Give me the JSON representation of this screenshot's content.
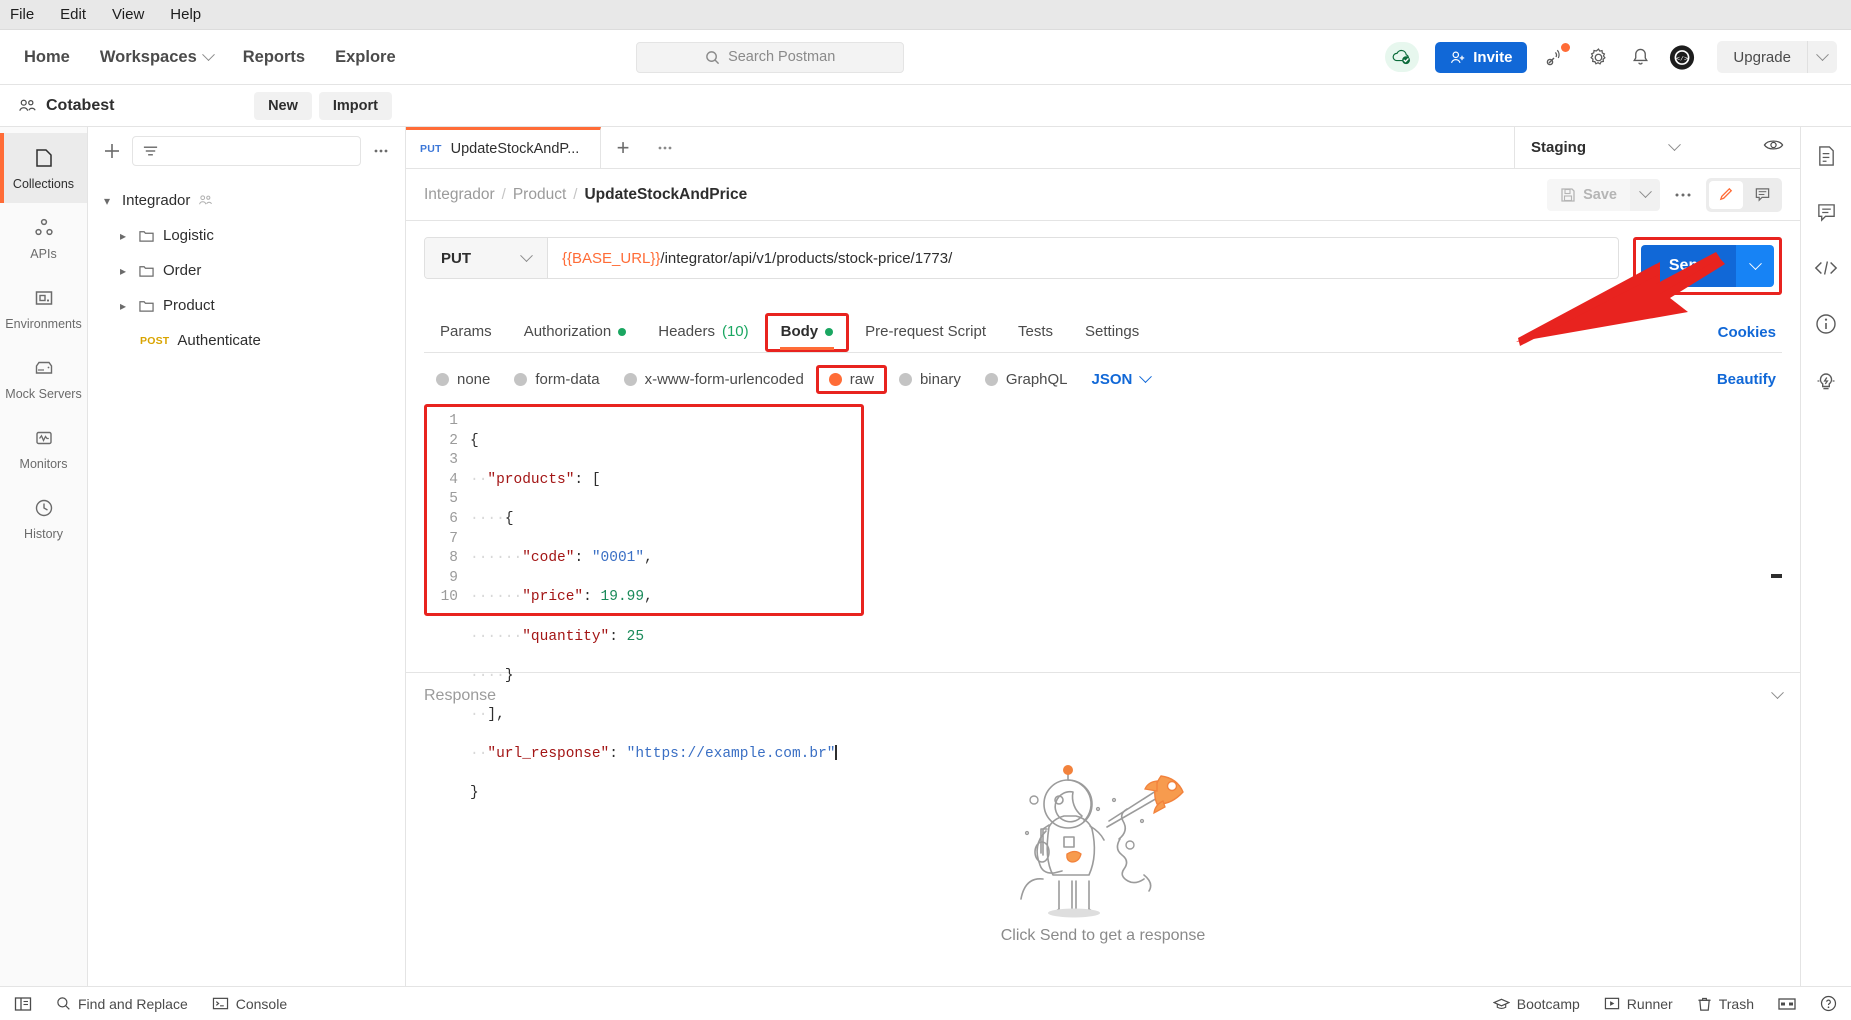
{
  "os_menu": [
    "File",
    "Edit",
    "View",
    "Help"
  ],
  "topnav": {
    "items": [
      "Home",
      "Workspaces",
      "Reports",
      "Explore"
    ],
    "search_placeholder": "Search Postman",
    "invite_label": "Invite",
    "upgrade_label": "Upgrade"
  },
  "workspace": {
    "name": "Cotabest",
    "new_label": "New",
    "import_label": "Import"
  },
  "rail": [
    {
      "label": "Collections",
      "icon": "collections-icon"
    },
    {
      "label": "APIs",
      "icon": "apis-icon"
    },
    {
      "label": "Environments",
      "icon": "environments-icon"
    },
    {
      "label": "Mock Servers",
      "icon": "mock-servers-icon"
    },
    {
      "label": "Monitors",
      "icon": "monitors-icon"
    },
    {
      "label": "History",
      "icon": "history-icon"
    }
  ],
  "collections": {
    "filter_placeholder": "",
    "root": "Integrador",
    "folders": [
      "Logistic",
      "Order",
      "Product"
    ],
    "request": {
      "method": "POST",
      "name": "Authenticate"
    }
  },
  "tab": {
    "method": "PUT",
    "title": "UpdateStockAndP...",
    "env_name": "Staging"
  },
  "breadcrumb": {
    "collection": "Integrador",
    "folder": "Product",
    "request": "UpdateStockAndPrice",
    "save_label": "Save"
  },
  "request": {
    "method": "PUT",
    "url_variable": "{{BASE_URL}}",
    "url_path": "/integrator/api/v1/products/stock-price/1773/",
    "send_label": "Send"
  },
  "request_tabs": [
    {
      "label": "Params",
      "dot": false,
      "count": null,
      "selected": false,
      "highlighted": false
    },
    {
      "label": "Authorization",
      "dot": true,
      "count": null,
      "selected": false,
      "highlighted": false
    },
    {
      "label": "Headers",
      "dot": false,
      "count": "(10)",
      "selected": false,
      "highlighted": false
    },
    {
      "label": "Body",
      "dot": true,
      "count": null,
      "selected": true,
      "highlighted": true
    },
    {
      "label": "Pre-request Script",
      "dot": false,
      "count": null,
      "selected": false,
      "highlighted": false
    },
    {
      "label": "Tests",
      "dot": false,
      "count": null,
      "selected": false,
      "highlighted": false
    },
    {
      "label": "Settings",
      "dot": false,
      "count": null,
      "selected": false,
      "highlighted": false
    }
  ],
  "cookies_label": "Cookies",
  "body_types": [
    {
      "label": "none",
      "selected": false,
      "highlighted": false
    },
    {
      "label": "form-data",
      "selected": false,
      "highlighted": false
    },
    {
      "label": "x-www-form-urlencoded",
      "selected": false,
      "highlighted": false
    },
    {
      "label": "raw",
      "selected": true,
      "highlighted": true
    },
    {
      "label": "binary",
      "selected": false,
      "highlighted": false
    },
    {
      "label": "GraphQL",
      "selected": false,
      "highlighted": false
    }
  ],
  "body_format": "JSON",
  "beautify_label": "Beautify",
  "editor": {
    "line_numbers": [
      "1",
      "2",
      "3",
      "4",
      "5",
      "6",
      "7",
      "8",
      "9",
      "10"
    ],
    "code_lines": [
      "{",
      "  \"products\": [",
      "    {",
      "      \"code\": \"0001\",",
      "      \"price\": 19.99,",
      "      \"quantity\": 25",
      "    }",
      "  ],",
      "  \"url_response\": \"https://example.com.br\"",
      "}"
    ]
  },
  "response": {
    "title": "Response",
    "hint": "Click Send to get a response"
  },
  "statusbar": {
    "left": [
      "Find and Replace",
      "Console"
    ],
    "right": [
      "Bootcamp",
      "Runner",
      "Trash"
    ]
  },
  "colors": {
    "accent": "#ff6c37",
    "primary": "#1168d7",
    "annotation_red": "#e8231f",
    "green_dot": "#1aa661"
  }
}
